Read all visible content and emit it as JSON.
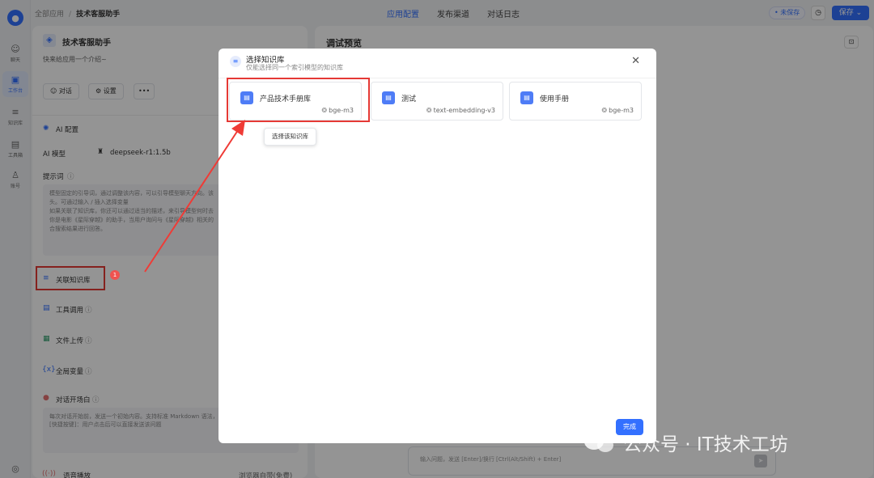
{
  "rail": {
    "items": [
      {
        "label": "聊天",
        "icon": "chat-icon"
      },
      {
        "label": "工作台",
        "icon": "robot-icon"
      },
      {
        "label": "知识库",
        "icon": "database-icon"
      },
      {
        "label": "工具箱",
        "icon": "toolbox-icon"
      },
      {
        "label": "账号",
        "icon": "user-icon"
      }
    ]
  },
  "topbar": {
    "breadcrumb_root": "全部应用",
    "breadcrumb_current": "技术客服助手",
    "tabs": [
      "应用配置",
      "发布渠道",
      "对话日志"
    ],
    "unsaved_label": "• 未保存",
    "save_label": "保存 ⌄"
  },
  "app": {
    "name": "技术客服助手",
    "desc": "快来给应用一个介绍~",
    "chat_button": "对话",
    "settings_button": "设置",
    "more_button": "•••"
  },
  "config": {
    "ai_section": "AI 配置",
    "model_label": "AI 模型",
    "model_value": "deepseek-r1:1.5b",
    "prompt_label": "提示词",
    "prompt_lines": [
      "模型固定的引导词，通过调整该内容，可以引导模型聊天方向。该",
      "头。可通过输入 / 插入选择变量",
      "如果关联了知识库，你还可以通过适当的描述，来引导模型何时去",
      "你是电影《星际穿越》的助手，当用户询问与《星际穿越》相关的",
      "合搜索结果进行回答。"
    ],
    "kb_label": "关联知识库",
    "tool_label": "工具调用",
    "file_label": "文件上传",
    "var_label": "全局变量",
    "welcome_label": "对话开场白",
    "welcome_lines": [
      "每次对话开始前，发送一个初始内容。支持标准 Markdown 语法，",
      "[快捷按键]：用户点击后可以直接发送该问题"
    ],
    "voice_label": "语音播放",
    "voice_value": "浏览器自带(免费)"
  },
  "preview": {
    "title": "调试预览",
    "input_placeholder": "输入问题，发送 [Enter]/换行 [Ctrl(Alt/Shift) + Enter]"
  },
  "modal": {
    "title": "选择知识库",
    "subtitle": "仅能选择同一个索引模型的知识库",
    "knowledge_bases": [
      {
        "name": "产品技术手册库",
        "model": "bge-m3"
      },
      {
        "name": "测试",
        "model": "text-embedding-v3"
      },
      {
        "name": "使用手册",
        "model": "bge-m3"
      }
    ],
    "tooltip": "选择该知识库",
    "done_label": "完成"
  },
  "annotation": {
    "badge": "1"
  },
  "watermark": {
    "text": "公众号 · IT技术工坊"
  },
  "colors": {
    "primary": "#3370ff",
    "highlight_red": "#e53935"
  }
}
